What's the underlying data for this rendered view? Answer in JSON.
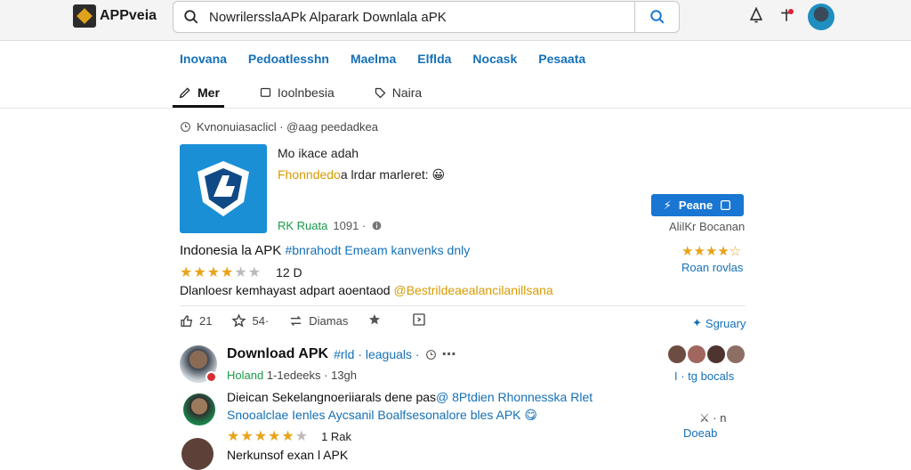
{
  "header": {
    "logo_text": "APPveia",
    "search_value": "NowrilersslaAPk Alparark Downlala aPK",
    "colors": {
      "accent": "#1976d2",
      "link": "#1570b8",
      "star": "#e8a317"
    }
  },
  "category_nav": [
    "Inovana",
    "Pedoatlesshn",
    "Maelma",
    "Elflda",
    "Nocask",
    "Pesaata"
  ],
  "tabs": [
    {
      "label": "Mer",
      "icon": "pen-icon"
    },
    {
      "label": "Ioolnbesia",
      "icon": "square-icon"
    },
    {
      "label": "Naira",
      "icon": "tag-icon"
    }
  ],
  "breadcrumb": "Kvnonuiasaclicl · @aag peedadkea",
  "app": {
    "name": "Mo ikace adah",
    "subtitle_highlight": "Fhonndedo",
    "subtitle_rest": "a lrdar marleret:",
    "subtitle_emoji": "😀",
    "meta_green": "RK Ruata",
    "meta_rest": "1091 ·",
    "install_label": "Peane",
    "install_sub": "AlilKr Bocanan"
  },
  "listing": {
    "title": "Indonesia la APK",
    "tags": "#bnrahodt Emeam kanvenks dnly",
    "rating_value": "12 D",
    "right_stars": "★★★★☆",
    "right_review": "Roan rovlas",
    "desc_text": "Dlanloesr kemhayast adpart aoentaod",
    "desc_highlight": "@Bestrildeaealancilanillsana"
  },
  "actions": {
    "like_count": "21",
    "star_count": "54·",
    "repost_label": "Diamas",
    "share_label": "Sgruary"
  },
  "post": {
    "title": "Download APK",
    "tag": "#rld · leaguals ·",
    "sub_green": "Holand",
    "sub_rest": "1-1edeeks · 13gh",
    "avatars_note": "I · tg bocals",
    "body_line1": "Dieican Sekelangnoeriiarals dene pas",
    "body_line1_tag": "@ 8Ptdien Rhonnesska Rlet",
    "body_line2": "Snooalclae Ienles Aycsanil Boalfsesonalore bles APK",
    "body_emoji": "😋",
    "rating_count": "1 Rak",
    "side_count": "· n",
    "side_link": "Doeab",
    "cut_text": "Nerkunsof exan l APK"
  }
}
